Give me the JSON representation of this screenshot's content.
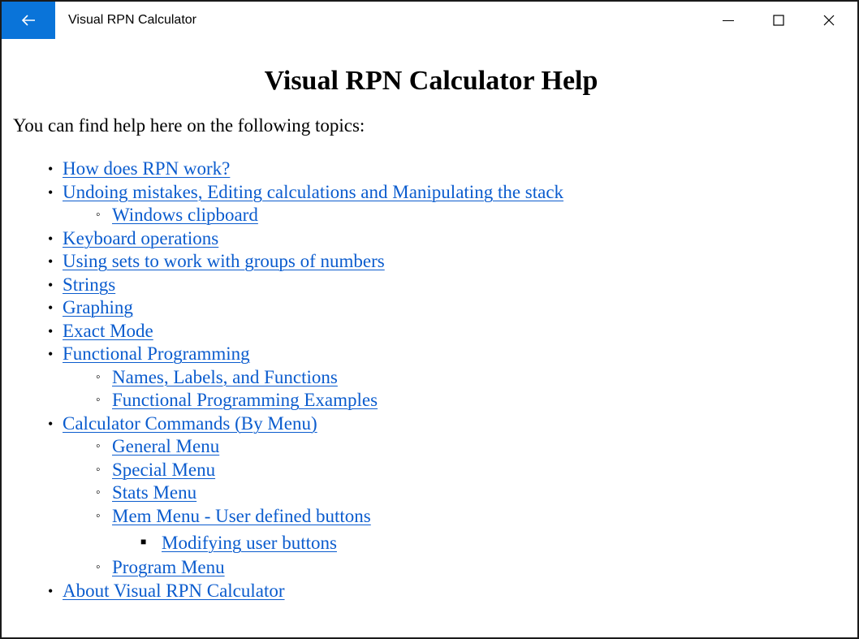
{
  "window": {
    "title": "Visual RPN Calculator"
  },
  "page": {
    "heading": "Visual RPN Calculator Help",
    "intro": "You can find help here on the following topics:"
  },
  "topics": [
    {
      "label": "How does RPN work?"
    },
    {
      "label": "Undoing mistakes, Editing calculations and Manipulating the stack",
      "children": [
        {
          "label": "Windows clipboard"
        }
      ]
    },
    {
      "label": "Keyboard operations"
    },
    {
      "label": "Using sets to work with groups of numbers"
    },
    {
      "label": "Strings"
    },
    {
      "label": "Graphing"
    },
    {
      "label": "Exact Mode"
    },
    {
      "label": "Functional Programming",
      "children": [
        {
          "label": "Names, Labels, and Functions"
        },
        {
          "label": "Functional Programming Examples"
        }
      ]
    },
    {
      "label": "Calculator Commands (By Menu)",
      "children": [
        {
          "label": "General Menu"
        },
        {
          "label": "Special Menu"
        },
        {
          "label": "Stats Menu"
        },
        {
          "label": "Mem Menu - User defined buttons",
          "children": [
            {
              "label": "Modifying user buttons"
            }
          ]
        },
        {
          "label": "Program Menu"
        }
      ]
    },
    {
      "label": "About Visual RPN Calculator"
    }
  ],
  "markers": {
    "l1": "•",
    "l2": "◦",
    "l3": "■"
  },
  "colors": {
    "accent": "#0a74d9",
    "link": "#0b5cce"
  },
  "icons": {
    "back": "arrow-left-icon",
    "minimize": "minimize-icon",
    "maximize": "maximize-icon",
    "close": "close-icon"
  }
}
